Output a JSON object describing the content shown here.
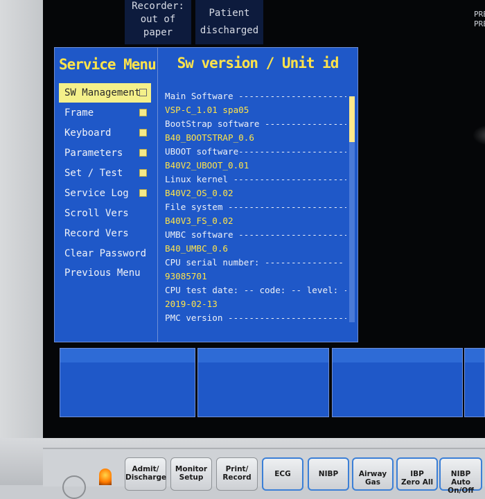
{
  "alarms": {
    "recorder": [
      "Recorder:",
      "out of",
      "paper"
    ],
    "patient": [
      "Patient",
      "discharged"
    ]
  },
  "corner_text": [
    "PRE",
    "PRE"
  ],
  "service_menu": {
    "title": "Service Menu",
    "items": [
      {
        "label": "SW Management",
        "submenu": true,
        "selected": true
      },
      {
        "label": "Frame",
        "submenu": true
      },
      {
        "label": "Keyboard",
        "submenu": true
      },
      {
        "label": "Parameters",
        "submenu": true
      },
      {
        "label": "Set / Test",
        "submenu": true
      },
      {
        "label": "Service Log",
        "submenu": true
      },
      {
        "label": "Scroll Vers",
        "submenu": false
      },
      {
        "label": "Record Vers",
        "submenu": false
      },
      {
        "label": "Clear Password",
        "submenu": false
      },
      {
        "label": "Previous Menu",
        "submenu": false
      }
    ]
  },
  "version_panel": {
    "title": "Sw version / Unit id",
    "lines": [
      {
        "text": "Main Software ----------------------",
        "kind": "label"
      },
      {
        "text": "VSP-C_1.01 spa05",
        "kind": "value"
      },
      {
        "text": "BootStrap software ----------------",
        "kind": "label"
      },
      {
        "text": "B40_BOOTSTRAP_0.6",
        "kind": "value"
      },
      {
        "text": "UBOOT software---------------------",
        "kind": "label"
      },
      {
        "text": "B40V2_UBOOT_0.01",
        "kind": "value"
      },
      {
        "text": "Linux kernel ----------------------",
        "kind": "label"
      },
      {
        "text": "B40V2_OS_0.02",
        "kind": "value"
      },
      {
        "text": "File system -----------------------",
        "kind": "label"
      },
      {
        "text": "B40V3_FS_0.02",
        "kind": "value"
      },
      {
        "text": "UMBC software ---------------------",
        "kind": "label"
      },
      {
        "text": "B40_UMBC_0.6",
        "kind": "value"
      },
      {
        "text": "CPU serial number: ---------------",
        "kind": "label"
      },
      {
        "text": "93085701",
        "kind": "value"
      },
      {
        "text": "CPU test date: -- code: -- level: --",
        "kind": "label"
      },
      {
        "text": "2019-02-13",
        "kind": "value"
      },
      {
        "text": "PMC version -----------------------",
        "kind": "label"
      }
    ],
    "scroll_position": 0
  },
  "hardware_keys": [
    {
      "label": "Admit/\nDischarge",
      "style": "plain"
    },
    {
      "label": "Monitor\nSetup",
      "style": "plain"
    },
    {
      "label": "Print/\nRecord",
      "style": "plain"
    },
    {
      "label": "ECG",
      "style": "blue"
    },
    {
      "label": "NIBP",
      "style": "blue"
    },
    {
      "label": "Airway\nGas",
      "style": "blue"
    },
    {
      "label": "IBP\nZero All",
      "style": "blue"
    },
    {
      "label": "NIBP\nAuto On/Off",
      "style": "blue"
    }
  ],
  "colors": {
    "panel_blue": "#1f58c8",
    "title_yellow": "#ffe44a",
    "selection": "#f4f08a",
    "led": "#ff8a00"
  }
}
